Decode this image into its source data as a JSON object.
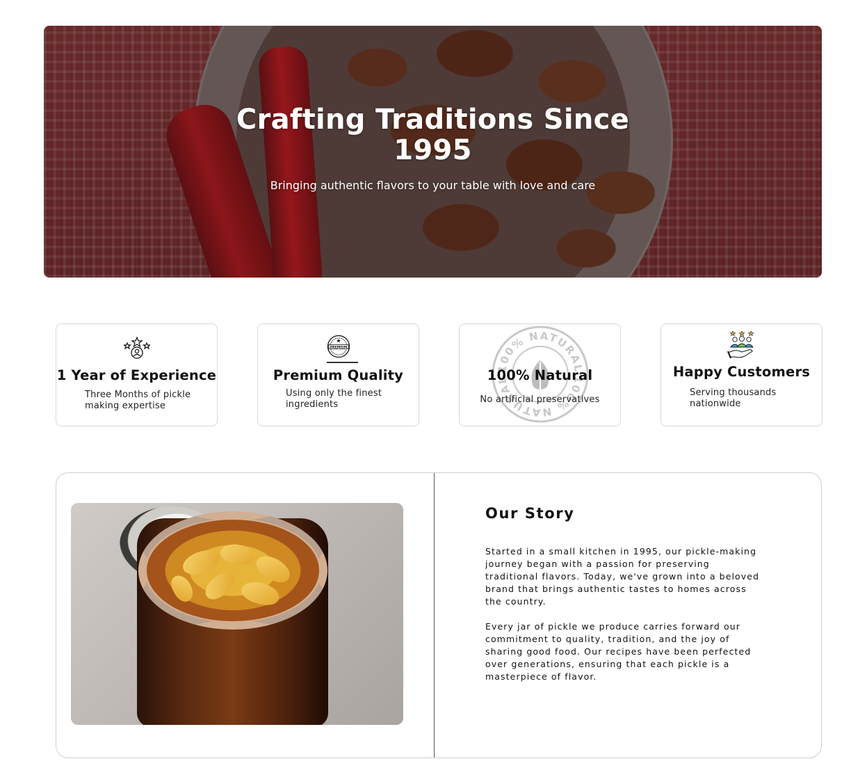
{
  "hero": {
    "title": "Crafting Traditions Since 1995",
    "subtitle": "Bringing authentic flavors to your table with love and care"
  },
  "features": [
    {
      "icon": "experience-award-icon",
      "title": "1 Year of Experience",
      "description": "Three Months of pickle making expertise"
    },
    {
      "icon": "premium-badge-icon",
      "title": "Premium Quality",
      "description": "Using only the finest ingredients",
      "badge_text": "PREMIUM"
    },
    {
      "icon": "natural-stamp-icon",
      "title": "100% Natural",
      "description": "No artificial preservatives",
      "stamp_text": "100% NATURAL"
    },
    {
      "icon": "happy-customers-icon",
      "title": "Happy Customers",
      "description": "Serving thousands nationwide"
    }
  ],
  "story": {
    "heading": "Our Story",
    "paragraphs": [
      "Started in a small kitchen in 1995, our pickle-making journey began with a passion for preserving traditional flavors. Today, we've grown into a beloved brand that brings authentic tastes to homes across the country.",
      "Every jar of pickle we produce carries forward our commitment to quality, tradition, and the joy of sharing good food. Our recipes have been perfected over generations, ensuring that each pickle is a masterpiece of flavor."
    ],
    "image": "pickle-jar-photo"
  },
  "colors": {
    "chili_red": "#b3161c",
    "text": "#111111",
    "card_border": "#d9d9d9",
    "stamp_gray": "#c8c8c8"
  }
}
